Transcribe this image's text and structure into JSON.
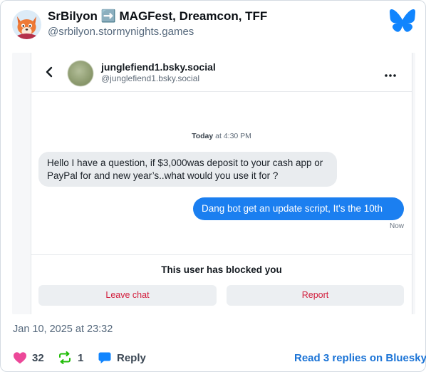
{
  "post": {
    "author_name": "SrBilyon ➡️ MAGFest, Dreamcon, TFF",
    "author_handle": "@srbilyon.stormynights.games",
    "date": "Jan 10, 2025 at 23:32",
    "like_count": "32",
    "repost_count": "1",
    "reply_label": "Reply",
    "read_replies_label": "Read 3 replies on Bluesky"
  },
  "screenshot": {
    "chat_name": "junglefiend1.bsky.social",
    "chat_handle": "@junglefiend1.bsky.social",
    "timestamp_day": "Today",
    "timestamp_time": "at 4:30 PM",
    "incoming_message": "Hello I have a question, if $3,000was deposit to your cash app or PayPal for and new year’s..what would you use it for ?",
    "outgoing_message": "Dang bot get an update script, It's the 10th",
    "sent_status": "Now",
    "blocked_notice": "This user has blocked you",
    "leave_chat_label": "Leave chat",
    "report_label": "Report"
  },
  "colors": {
    "accent_blue": "#1185fe",
    "like_pink": "#ec4899",
    "repost_green": "#20bc07",
    "outgoing_bubble": "#1b7ff0",
    "danger_red": "#d21d3c"
  },
  "icons": {
    "logo": "bluesky-butterfly-icon",
    "like": "heart-icon",
    "repost": "repost-icon",
    "reply": "speech-bubble-icon",
    "back": "chevron-left-icon",
    "more": "more-dots-icon"
  }
}
